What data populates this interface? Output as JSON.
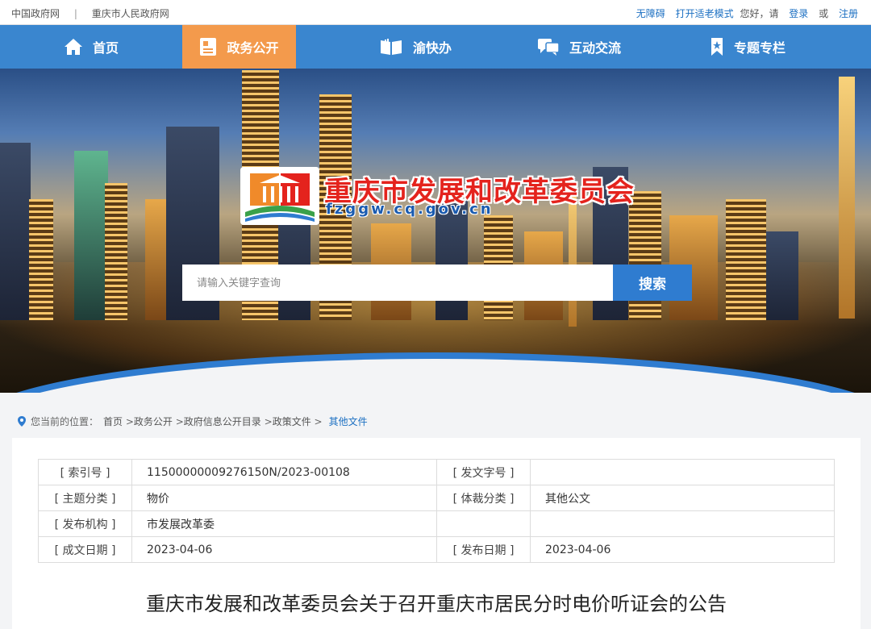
{
  "topbar": {
    "left_links": [
      "中国政府网",
      "重庆市人民政府网"
    ],
    "accessibility": "无障碍",
    "elder_mode": "打开适老模式",
    "greeting": "您好，请",
    "login": "登录",
    "or": "或",
    "register": "注册"
  },
  "nav": {
    "items": [
      {
        "label": "首页",
        "icon": "home-icon"
      },
      {
        "label": "政务公开",
        "icon": "document-icon"
      },
      {
        "label": "渝快办",
        "icon": "book-icon"
      },
      {
        "label": "互动交流",
        "icon": "chat-icon"
      },
      {
        "label": "专题专栏",
        "icon": "bookmark-icon"
      }
    ],
    "active_index": 1,
    "colors": {
      "bar": "#3a86cf",
      "active": "#f39a4c"
    }
  },
  "banner": {
    "site_name": "重庆市发展和改革委员会",
    "domain": "fzggw.cq.gov.cn",
    "search_placeholder": "请输入关键字查询",
    "search_button": "搜索"
  },
  "breadcrumb": {
    "prefix": "您当前的位置：",
    "items": [
      "首页",
      "政务公开",
      "政府信息公开目录",
      "政策文件"
    ],
    "current": "其他文件"
  },
  "meta": {
    "rows": [
      {
        "k1": "[ 索引号 ]",
        "v1": "11500000009276150N/2023-00108",
        "k2": "[ 发文字号 ]",
        "v2": ""
      },
      {
        "k1": "[ 主题分类 ]",
        "v1": "物价",
        "k2": "[ 体裁分类 ]",
        "v2": "其他公文"
      },
      {
        "k1": "[ 发布机构 ]",
        "v1": "市发展改革委",
        "k2": "",
        "v2": ""
      },
      {
        "k1": "[ 成文日期 ]",
        "v1": "2023-04-06",
        "k2": "[ 发布日期 ]",
        "v2": "2023-04-06"
      }
    ]
  },
  "document": {
    "title": "重庆市发展和改革委员会关于召开重庆市居民分时电价听证会的公告"
  }
}
